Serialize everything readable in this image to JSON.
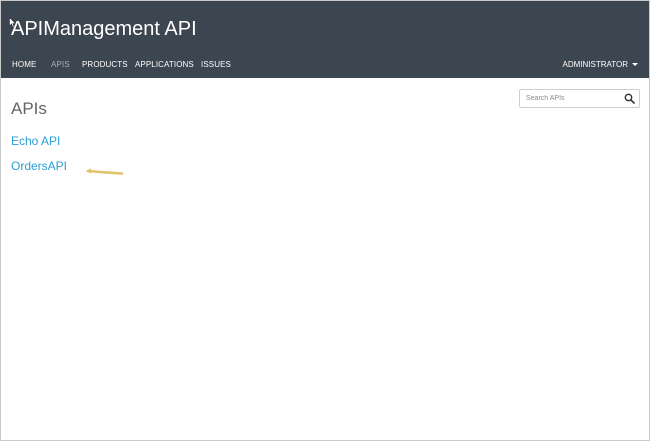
{
  "header": {
    "title": "APIManagement API",
    "nav": [
      {
        "label": "HOME",
        "active": false
      },
      {
        "label": "APIS",
        "active": true
      },
      {
        "label": "PRODUCTS",
        "active": false
      },
      {
        "label": "APPLICATIONS",
        "active": false
      },
      {
        "label": "ISSUES",
        "active": false
      }
    ],
    "user_menu": "ADMINISTRATOR"
  },
  "main": {
    "page_title": "APIs",
    "search": {
      "placeholder": "Search APIs",
      "value": ""
    },
    "apis": [
      {
        "name": "Echo API"
      },
      {
        "name": "OrdersAPI"
      }
    ]
  },
  "colors": {
    "header_bg": "#3c4650",
    "link": "#2a9fd6",
    "nav_active": "#a9b1b8",
    "annotation_arrow": "#e0c36a"
  },
  "icons": {
    "search": "search-icon",
    "dropdown": "caret-down-icon",
    "cursor": "mouse-pointer-icon",
    "annotation": "arrow-left-icon"
  }
}
